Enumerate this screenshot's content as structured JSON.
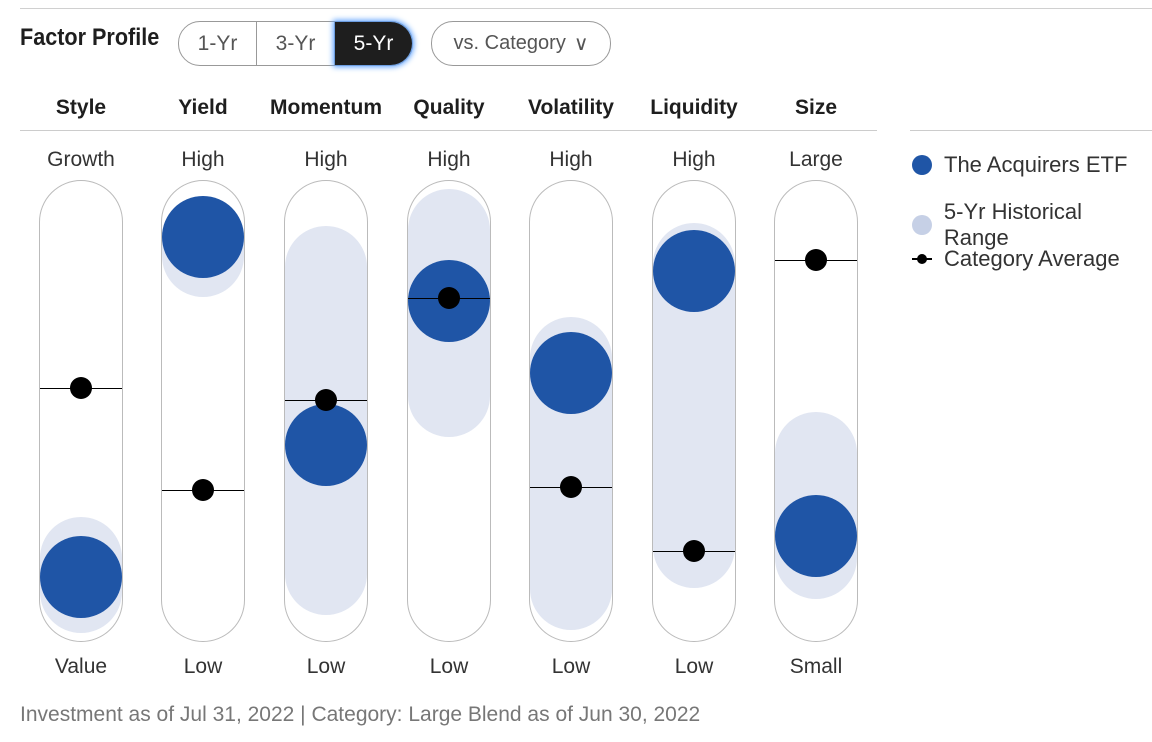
{
  "title": "Factor Profile",
  "periods": [
    "1-Yr",
    "3-Yr",
    "5-Yr"
  ],
  "selected_period": "5-Yr",
  "compare": "vs. Category",
  "chart_data": {
    "type": "factor-profile",
    "scale_note": "positions as percent of range from low (0) to high (100)",
    "factors": [
      {
        "name": "Style",
        "top": "Growth",
        "bottom": "Value",
        "fund": 6,
        "category_avg": 56,
        "range": [
          2,
          11
        ]
      },
      {
        "name": "Yield",
        "top": "High",
        "bottom": "Low",
        "fund": 96,
        "category_avg": 29,
        "range": [
          91,
          96
        ]
      },
      {
        "name": "Momentum",
        "top": "High",
        "bottom": "Low",
        "fund": 41,
        "category_avg": 53,
        "range": [
          7,
          88
        ]
      },
      {
        "name": "Quality",
        "top": "High",
        "bottom": "Low",
        "fund": 79,
        "category_avg": 80,
        "range": [
          54,
          98
        ]
      },
      {
        "name": "Volatility",
        "top": "High",
        "bottom": "Low",
        "fund": 60,
        "category_avg": 30,
        "range": [
          3,
          64
        ]
      },
      {
        "name": "Liquidity",
        "top": "High",
        "bottom": "Low",
        "fund": 87,
        "category_avg": 13,
        "range": [
          14,
          89
        ]
      },
      {
        "name": "Size",
        "top": "Large",
        "bottom": "Small",
        "fund": 17,
        "category_avg": 90,
        "range": [
          11,
          39
        ]
      }
    ],
    "legend": [
      "The Acquirers ETF",
      "5-Yr Historical Range",
      "Category Average"
    ],
    "colors": {
      "fund": "#1f55a6",
      "range": "#c6d0e6",
      "avg": "#000000"
    }
  },
  "footer": "Investment as of Jul 31, 2022 | Category: Large Blend as of Jun 30, 2022"
}
